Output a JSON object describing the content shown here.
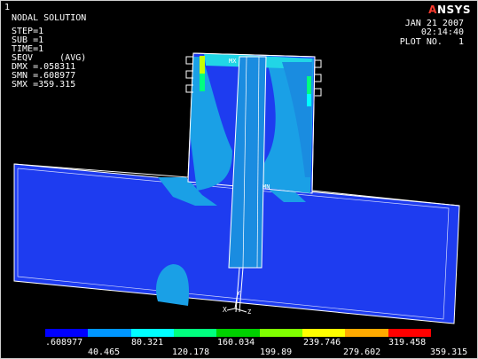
{
  "window": {
    "number": "1"
  },
  "info": {
    "title": "NODAL SOLUTION",
    "lines": [
      "STEP=1",
      "SUB =1",
      "TIME=1",
      "SEQV     (AVG)",
      "DMX =.058311",
      "SMN =.608977",
      "SMX =359.315"
    ]
  },
  "header": {
    "brand_a": "A",
    "brand_rest": "NSYS",
    "date": "JAN 21 2007",
    "time": "02:14:40",
    "plot_no": "PLOT NO.   1"
  },
  "markers": {
    "mx": "MX",
    "mn": "MN",
    "axis_y": "Y",
    "axis_x": "X",
    "axis_z": "Z"
  },
  "legend": {
    "colors": [
      "#0000ff",
      "#0096ff",
      "#00ffff",
      "#00ff7f",
      "#00d000",
      "#7fff00",
      "#ffff00",
      "#ffaa00",
      "#ff0000"
    ],
    "labels_top": [
      ".608977",
      "80.321",
      "160.034",
      "239.746",
      "319.458"
    ],
    "labels_bottom": [
      "40.465",
      "120.178",
      "199.89",
      "279.602",
      "359.315"
    ]
  },
  "colors": {
    "background": "#000000",
    "low": "#1a3df5",
    "mid": "#1aa0e6",
    "outline": "#ffffff"
  }
}
